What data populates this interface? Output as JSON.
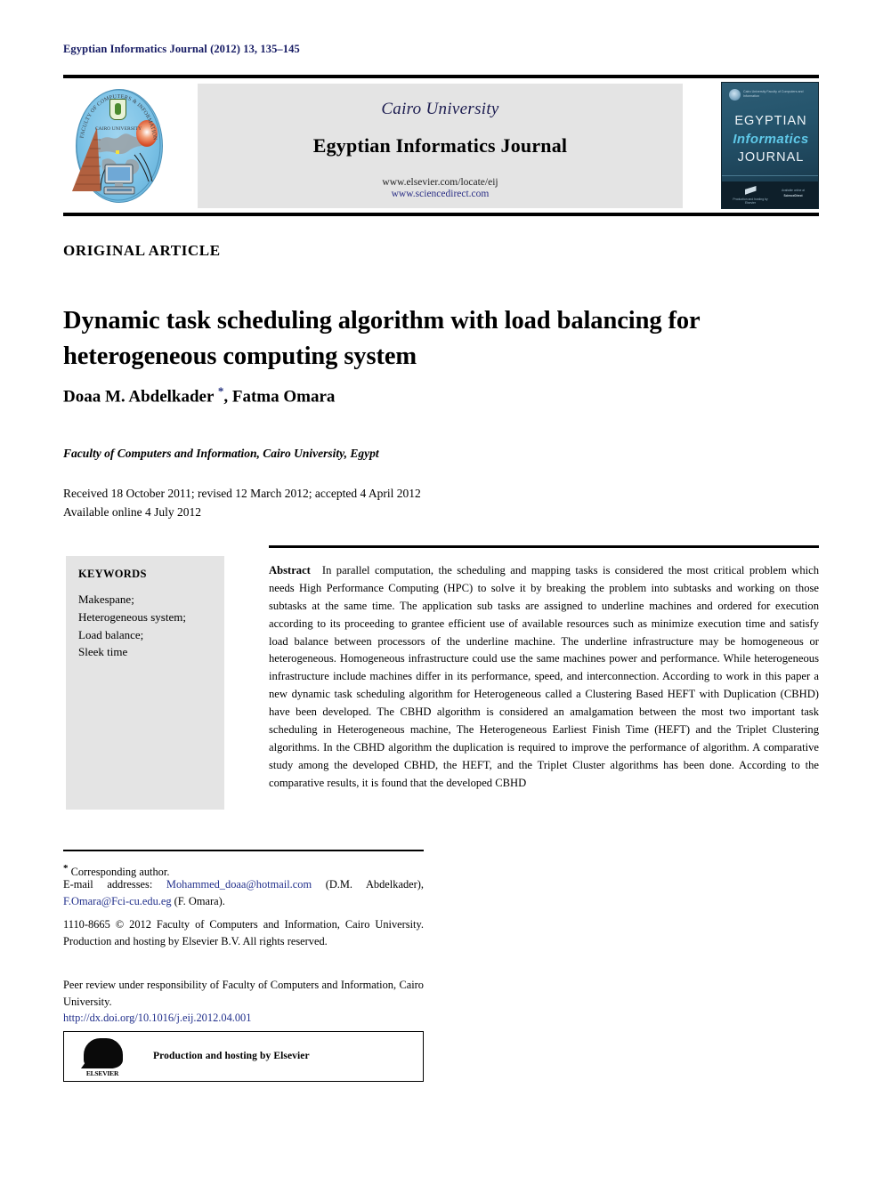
{
  "running_head": "Egyptian Informatics Journal (2012) 13, 135–145",
  "masthead": {
    "university": "Cairo University",
    "journal_title": "Egyptian Informatics Journal",
    "url_elsevier": "www.elsevier.com/locate/eij",
    "url_sciencedirect": "www.sciencedirect.com",
    "left_logo_name": "cairo-university-faculty-of-computers-and-information-logo",
    "left_logo_ring_text": "FACULTY OF COMPUTERS & INFORMATION",
    "left_logo_inner_text": "CAIRO UNIVERSITY",
    "cover": {
      "line1": "EGYPTIAN",
      "line2": "Informatics",
      "line3": "JOURNAL",
      "emblem_caption": "Cairo University Faculty of Computers and Information",
      "footer_left": "Production and hosting by Elsevier",
      "footer_right_top": "Available online at",
      "footer_right_bottom": "ScienceDirect"
    }
  },
  "article": {
    "type": "ORIGINAL ARTICLE",
    "title": "Dynamic task scheduling algorithm with load balancing for heterogeneous computing system",
    "authors_pre": "Doaa M. Abdelkader ",
    "corresponding_mark": "*",
    "authors_post": ", Fatma Omara",
    "affiliation": "Faculty of Computers and Information, Cairo University, Egypt",
    "received_line": "Received 18 October 2011; revised 12 March 2012; accepted 4 April 2012",
    "available_line": "Available online 4 July 2012"
  },
  "keywords": {
    "heading": "KEYWORDS",
    "items": "Makespane;\nHeterogeneous system;\nLoad balance;\nSleek time"
  },
  "abstract": {
    "label": "Abstract",
    "text": "In parallel computation, the scheduling and mapping tasks is considered the most critical problem which needs High Performance Computing (HPC) to solve it by breaking the problem into subtasks and working on those subtasks at the same time. The application sub tasks are assigned to underline machines and ordered for execution according to its proceeding to grantee efficient use of available resources such as minimize execution time and satisfy load balance between processors of the underline machine. The underline infrastructure may be homogeneous or heterogeneous. Homogeneous infrastructure could use the same machines power and performance. While heterogeneous infrastructure include machines differ in its performance, speed, and interconnection. According to work in this paper a new dynamic task scheduling algorithm for Heterogeneous called a Clustering Based HEFT with Duplication (CBHD) have been developed. The CBHD algorithm is considered an amalgamation between the most two important task scheduling in Heterogeneous machine, The Heterogeneous Earliest Finish Time (HEFT) and the Triplet Clustering algorithms. In the CBHD algorithm the duplication is required to improve the performance of algorithm. A comparative study among the developed CBHD, the HEFT, and the Triplet Cluster algorithms has been done. According to the comparative results, it is found that the developed CBHD"
  },
  "footnotes": {
    "corresponding_star": "*",
    "corresponding_text": " Corresponding author.",
    "email_label": "E-mail addresses: ",
    "email_1": "Mohammed_doaa@hotmail.com",
    "email_1_owner": " (D.M. Abdelkader), ",
    "email_2": "F.Omara@Fci-cu.edu.eg",
    "email_2_owner": " (F. Omara).",
    "copyright": "1110-8665 © 2012 Faculty of Computers and Information, Cairo University. Production and hosting by Elsevier B.V. All rights reserved.",
    "peer_review": "Peer review under responsibility of Faculty of Computers and Information, Cairo University.",
    "doi": "http://dx.doi.org/10.1016/j.eij.2012.04.001",
    "elsevier_box_text": "Production and hosting by Elsevier",
    "elsevier_wordmark": "ELSEVIER"
  },
  "colors": {
    "running_head": "#151a63",
    "link": "#22308c",
    "band_gray": "#e4e4e4",
    "rule_black": "#000000"
  }
}
